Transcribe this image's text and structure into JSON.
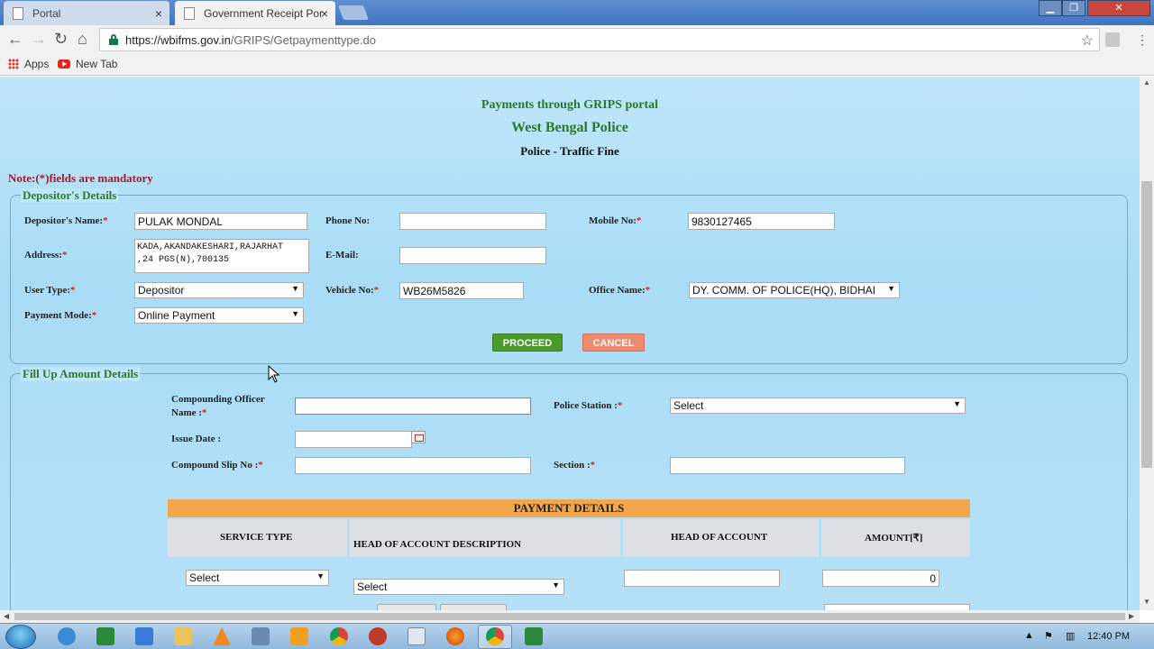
{
  "browser": {
    "tabs": [
      {
        "label": "Portal",
        "active": false
      },
      {
        "label": "Government Receipt Por",
        "active": true
      }
    ],
    "url_host": "https://wbifms.gov.in",
    "url_path": "/GRIPS/Getpaymenttype.do",
    "bookmarks": [
      "Apps",
      "New Tab"
    ]
  },
  "header": {
    "line1": "Payments through GRIPS portal",
    "line2": "West Bengal Police",
    "line3": "Police - Traffic Fine"
  },
  "note": "Note:(*)fields are mandatory",
  "depositor": {
    "legend": "Depositor's Details",
    "name_label": "Depositor's Name:",
    "name_value": "PULAK MONDAL",
    "phone_label": "Phone No:",
    "phone_value": "",
    "mobile_label": "Mobile No:",
    "mobile_value": "9830127465",
    "address_label": "Address:",
    "address_value": "KADA,AKANDAKESHARI,RAJARHAT\n,24 PGS(N),700135",
    "email_label": "E-Mail:",
    "email_value": "",
    "usertype_label": "User Type:",
    "usertype_value": "Depositor",
    "vehicle_label": "Vehicle No:",
    "vehicle_value": "WB26M5826",
    "office_label": "Office Name:",
    "office_value": "DY. COMM. OF POLICE(HQ), BIDHAI",
    "paymode_label": "Payment Mode:",
    "paymode_value": "Online Payment",
    "proceed": "PROCEED",
    "cancel": "CANCEL"
  },
  "amount": {
    "legend": "Fill Up Amount Details",
    "officer_label_1": "Compounding Officer",
    "officer_label_2": "Name :",
    "officer_value": "",
    "police_station_label": "Police Station :",
    "police_station_value": "Select",
    "issue_date_label": "Issue Date :",
    "issue_date_value": "",
    "slip_label": "Compound Slip No :",
    "slip_value": "",
    "section_label": "Section :",
    "section_value": ""
  },
  "payment": {
    "title": "PAYMENT DETAILS",
    "columns": [
      "SERVICE TYPE",
      "HEAD OF ACCOUNT DESCRIPTION",
      "HEAD OF ACCOUNT",
      "AMOUNT[₹]"
    ],
    "service_type_value": "Select",
    "description_value": "Select",
    "head_of_account_value": "",
    "amount_value": "0"
  },
  "taskbar": {
    "clock": "12:40 PM"
  }
}
